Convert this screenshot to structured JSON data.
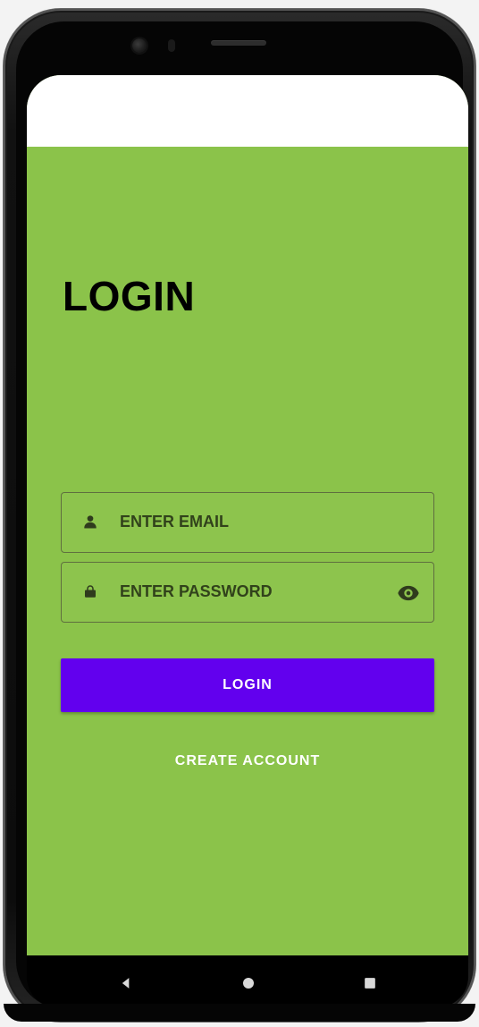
{
  "screen": {
    "title": "LOGIN",
    "email_placeholder": "ENTER EMAIL",
    "password_placeholder": "ENTER PASSWORD",
    "login_button": "LOGIN",
    "create_account": "CREATE ACCOUNT"
  },
  "icons": {
    "person": "person-icon",
    "lock": "lock-icon",
    "eye": "eye-icon",
    "back": "back-icon",
    "home": "home-icon",
    "recent": "recent-apps-icon"
  },
  "colors": {
    "background": "#8bc34a",
    "button": "#6200ee",
    "status_area": "#ffffff",
    "text_dark": "#000000",
    "field_text": "#31421b"
  }
}
